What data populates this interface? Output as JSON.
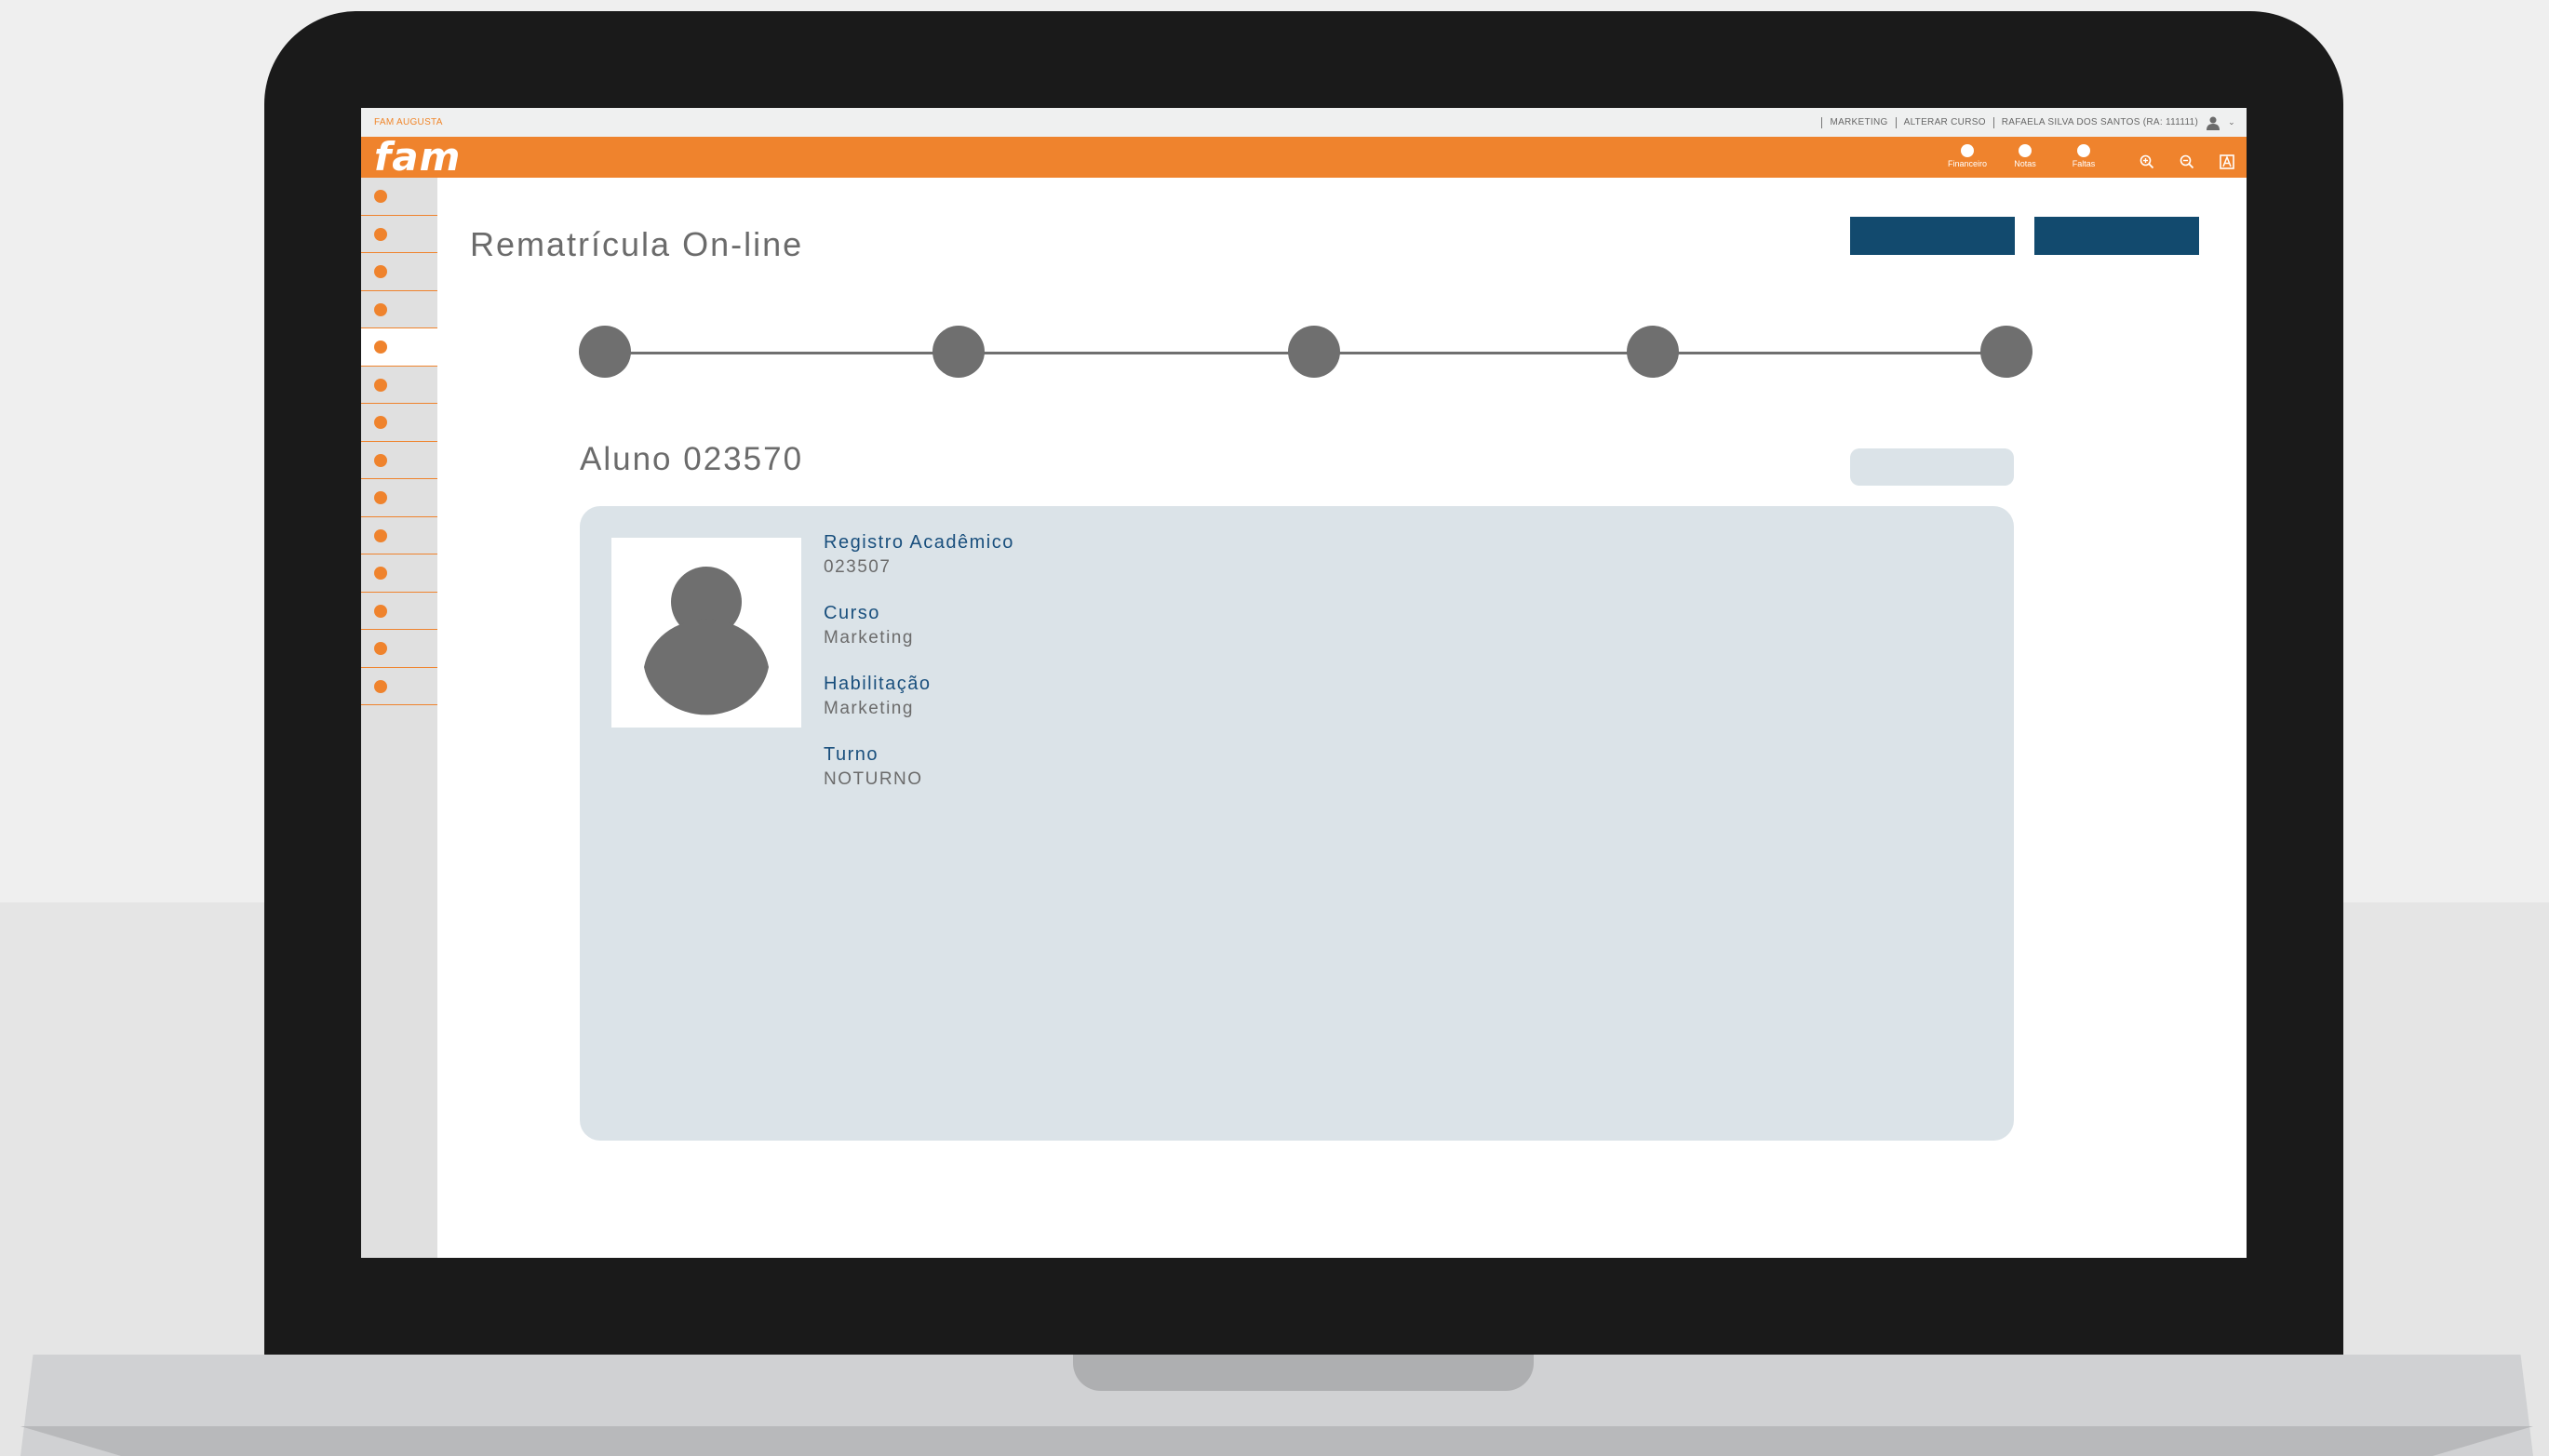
{
  "topbar": {
    "campus": "FAM AUGUSTA",
    "links": [
      "MARKETING",
      "ALTERAR CURSO",
      "RAFAELA SILVA DOS SANTOS (RA: 111111)"
    ]
  },
  "header": {
    "logo": "fam",
    "items": [
      {
        "label": "Financeiro",
        "icon": "circle-icon"
      },
      {
        "label": "Notas",
        "icon": "circle-icon"
      },
      {
        "label": "Faltas",
        "icon": "circle-icon"
      }
    ],
    "tools": [
      "zoom-in-icon",
      "zoom-out-icon",
      "contrast-icon"
    ]
  },
  "sidebar": {
    "item_count": 14,
    "active_index": 4
  },
  "main": {
    "title": "Rematrícula On-line",
    "stepper_steps": 5
  },
  "student": {
    "title": "Aluno 023570",
    "fields": [
      {
        "label": "Registro Acadêmico",
        "value": "023507"
      },
      {
        "label": "Curso",
        "value": "Marketing"
      },
      {
        "label": "Habilitação",
        "value": "Marketing"
      },
      {
        "label": "Turno",
        "value": "NOTURNO"
      }
    ]
  },
  "colors": {
    "brand_orange": "#ef832d",
    "button_navy": "#124a6e",
    "label_blue": "#194f7d",
    "card_bg": "#dbe3e8"
  }
}
